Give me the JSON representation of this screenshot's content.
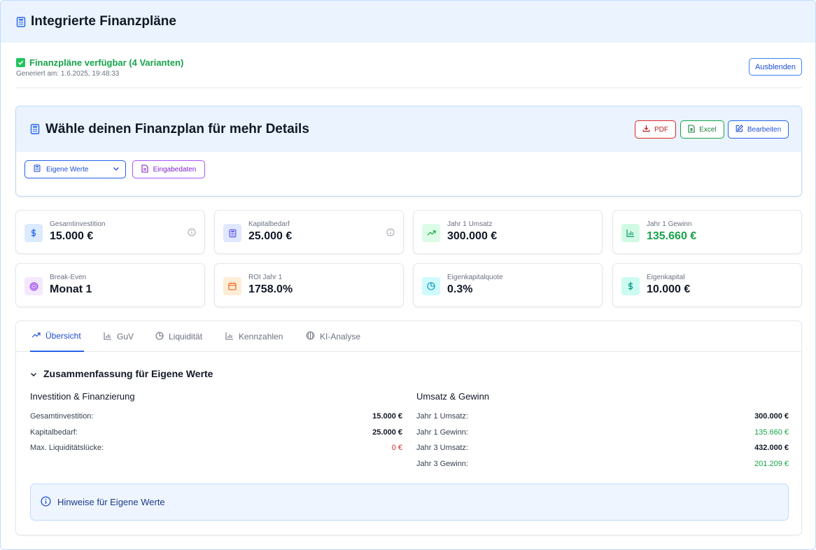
{
  "header": {
    "title": "Integrierte Finanzpläne",
    "icon": "calculator-icon"
  },
  "status": {
    "message": "Finanzpläne verfügbar (4 Varianten)",
    "generated": "Generiert am: 1.6.2025, 19:48:33",
    "hide_label": "Ausblenden"
  },
  "plan": {
    "title": "Wähle deinen Finanzplan für mehr Details",
    "pdf_label": "PDF",
    "excel_label": "Excel",
    "edit_label": "Bearbeiten",
    "select_value": "Eigene Werte",
    "input_label": "Eingabedaten"
  },
  "kpis": [
    {
      "label": "Gesamtinvestition",
      "value": "15.000 €",
      "icon": "dollar-icon",
      "color": "#dbeafe"
    },
    {
      "label": "Kapitalbedarf",
      "value": "25.000 €",
      "icon": "calculator-icon",
      "color": "#e0e7ff"
    },
    {
      "label": "Jahr 1 Umsatz",
      "value": "300.000 €",
      "icon": "trend-up-icon",
      "color": "#dcfce7"
    },
    {
      "label": "Jahr 1 Gewinn",
      "value": "135.660 €",
      "icon": "bar-chart-icon",
      "color": "#d1fae5"
    },
    {
      "label": "Break-Even",
      "value": "Monat 1",
      "icon": "target-icon",
      "color": "#f3e8ff"
    },
    {
      "label": "ROI Jahr 1",
      "value": "1758.0%",
      "icon": "calendar-icon",
      "color": "#ffedd5"
    },
    {
      "label": "Eigenkapitalquote",
      "value": "0.3%",
      "icon": "pie-chart-icon",
      "color": "#cffafe"
    },
    {
      "label": "Eigenkapital",
      "value": "10.000 €",
      "icon": "dollar-icon",
      "color": "#ccfbf1"
    }
  ],
  "tabs": [
    {
      "label": "Übersicht",
      "icon": "trend-up-icon"
    },
    {
      "label": "GuV",
      "icon": "bar-chart-icon"
    },
    {
      "label": "Liquidität",
      "icon": "pie-chart-icon"
    },
    {
      "label": "Kennzahlen",
      "icon": "bar-chart-icon"
    },
    {
      "label": "KI-Analyse",
      "icon": "brain-icon"
    }
  ],
  "summary": {
    "title": "Zusammenfassung für Eigene Werte",
    "left": {
      "heading": "Investition & Finanzierung",
      "rows": [
        {
          "label": "Gesamtinvestition:",
          "value": "15.000 €"
        },
        {
          "label": "Kapitalbedarf:",
          "value": "25.000 €"
        },
        {
          "label": "Max. Liquiditätslücke:",
          "value": "0 €"
        }
      ]
    },
    "right": {
      "heading": "Umsatz & Gewinn",
      "rows": [
        {
          "label": "Jahr 1 Umsatz:",
          "value": "300.000 €"
        },
        {
          "label": "Jahr 1 Gewinn:",
          "value": "135.660 €"
        },
        {
          "label": "Jahr 3 Umsatz:",
          "value": "432.000 €"
        },
        {
          "label": "Jahr 3 Gewinn:",
          "value": "201.209 €"
        }
      ]
    },
    "notice": "Hinweise für Eigene Werte"
  },
  "colors": {
    "accent": "#2563eb",
    "success": "#16a34a",
    "danger": "#dc2626"
  }
}
